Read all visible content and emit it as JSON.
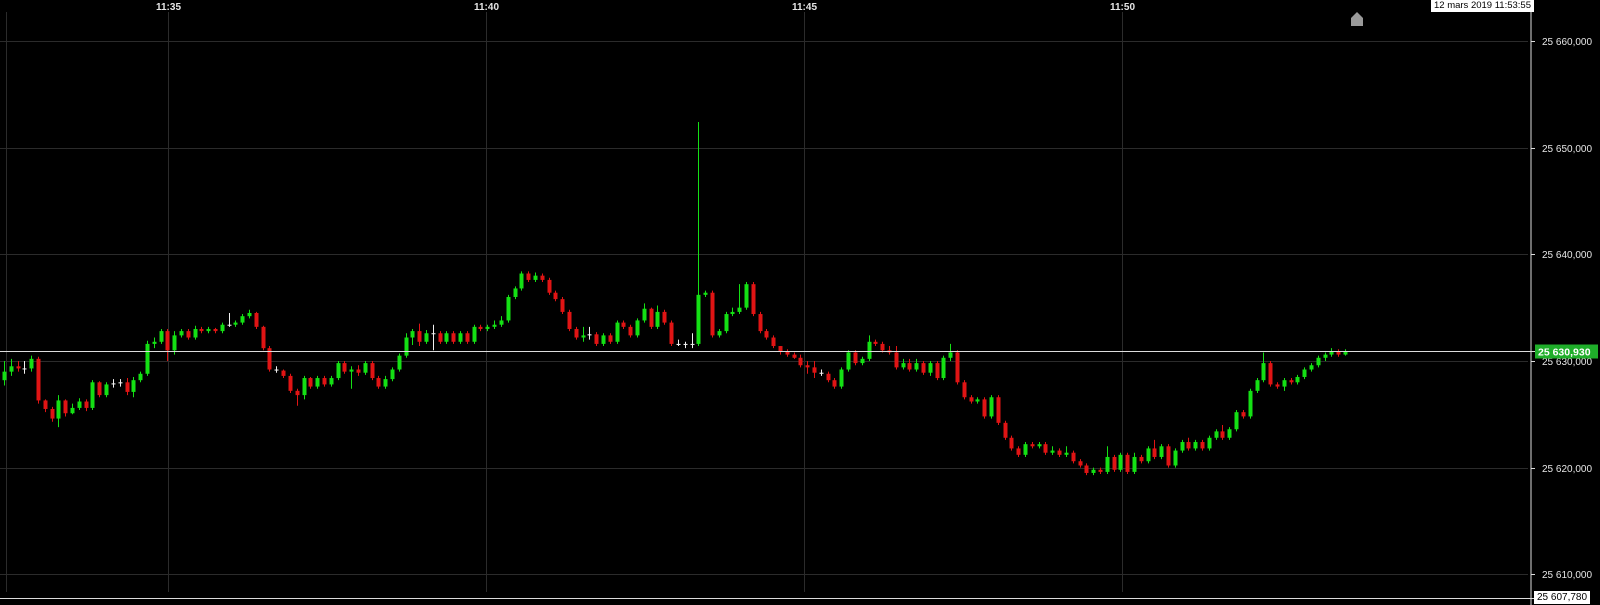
{
  "header": {
    "datetime": "12 mars 2019 11:53:55"
  },
  "colors": {
    "up": "#14e014",
    "down": "#e01414",
    "doji": "#f0f0f0",
    "grid": "#2b2b2b",
    "badge": "#1fae2a",
    "axis_text": "#e6e6e6"
  },
  "icons": {
    "scroll_marker": "home-arrow-icon"
  },
  "chart_data": {
    "type": "candlestick",
    "y_axis": {
      "min": 25607.78,
      "max": 25662,
      "ticks": [
        25610,
        25620,
        25630,
        25640,
        25650,
        25660
      ],
      "tick_labels": [
        "25 610,000",
        "25 620,000",
        "25 630,000",
        "25 640,000",
        "25 650,000",
        "25 660,000"
      ],
      "position": "right"
    },
    "x_axis": {
      "start": "11:32:25",
      "end": "11:53:30",
      "ticks": [
        "11:35",
        "11:40",
        "11:45",
        "11:50"
      ],
      "position": "top"
    },
    "last_price": {
      "value": 25630.93,
      "label": "25 630,930"
    },
    "low_marker": {
      "value": 25607.78,
      "label": "25 607,780"
    },
    "grid": true,
    "candles": [
      [
        25628.2,
        25629.0,
        25630.0,
        25627.7
      ],
      [
        25629.0,
        25629.5,
        25630.2,
        25628.6
      ],
      [
        25629.5,
        25629.3,
        25630.0,
        25629.0
      ],
      [
        25629.3,
        25629.3,
        25630.0,
        25628.8
      ],
      [
        25629.3,
        25630.2,
        25630.5,
        25629.0
      ],
      [
        25630.2,
        25626.3,
        25630.4,
        25626.0
      ],
      [
        25626.3,
        25625.5,
        25626.4,
        25625.2
      ],
      [
        25625.5,
        25624.6,
        25625.7,
        25624.3
      ],
      [
        25624.6,
        25626.3,
        25626.8,
        25623.8
      ],
      [
        25626.3,
        25625.1,
        25626.4,
        25624.8
      ],
      [
        25625.1,
        25625.6,
        25626.0,
        25625.0
      ],
      [
        25625.6,
        25626.2,
        25626.5,
        25625.4
      ],
      [
        25626.2,
        25625.6,
        25626.4,
        25625.3
      ],
      [
        25625.6,
        25628.0,
        25628.2,
        25625.4
      ],
      [
        25628.0,
        25626.8,
        25628.1,
        25626.6
      ],
      [
        25626.8,
        25627.8,
        25628.0,
        25626.6
      ],
      [
        25627.8,
        25627.9,
        25628.3,
        25627.5
      ],
      [
        25627.9,
        25628.0,
        25628.3,
        25627.6
      ],
      [
        25628.0,
        25627.1,
        25628.4,
        25626.8
      ],
      [
        25627.1,
        25628.2,
        25628.5,
        25626.6
      ],
      [
        25628.2,
        25628.8,
        25629.0,
        25628.0
      ],
      [
        25628.8,
        25631.6,
        25631.9,
        25628.6
      ],
      [
        25631.6,
        25631.8,
        25632.2,
        25631.2
      ],
      [
        25631.8,
        25632.8,
        25633.0,
        25631.6
      ],
      [
        25632.8,
        25631.0,
        25633.0,
        25630.0
      ],
      [
        25631.0,
        25632.4,
        25632.8,
        25630.6
      ],
      [
        25632.4,
        25632.8,
        25633.0,
        25632.2
      ],
      [
        25632.8,
        25632.2,
        25633.0,
        25632.0
      ],
      [
        25632.2,
        25633.0,
        25633.3,
        25632.0
      ],
      [
        25633.0,
        25632.8,
        25633.2,
        25632.6
      ],
      [
        25632.8,
        25633.0,
        25633.2,
        25632.6
      ],
      [
        25633.0,
        25632.8,
        25633.1,
        25632.6
      ],
      [
        25632.8,
        25633.4,
        25633.6,
        25632.6
      ],
      [
        25633.4,
        25633.4,
        25634.5,
        25633.2
      ],
      [
        25633.4,
        25633.6,
        25633.8,
        25633.2
      ],
      [
        25633.6,
        25634.2,
        25634.4,
        25633.4
      ],
      [
        25634.2,
        25634.5,
        25634.8,
        25634.0
      ],
      [
        25634.5,
        25633.2,
        25634.6,
        25633.0
      ],
      [
        25633.2,
        25631.2,
        25633.3,
        25631.0
      ],
      [
        25631.2,
        25629.2,
        25631.4,
        25629.0
      ],
      [
        25629.2,
        25629.1,
        25629.5,
        25628.9
      ],
      [
        25629.1,
        25628.6,
        25629.2,
        25628.4
      ],
      [
        25628.6,
        25627.2,
        25628.8,
        25627.0
      ],
      [
        25627.2,
        25626.8,
        25627.4,
        25625.8
      ],
      [
        25626.8,
        25628.4,
        25628.6,
        25626.4
      ],
      [
        25628.4,
        25627.6,
        25628.5,
        25627.4
      ],
      [
        25627.6,
        25628.4,
        25628.6,
        25627.4
      ],
      [
        25628.4,
        25627.8,
        25628.6,
        25627.6
      ],
      [
        25627.8,
        25628.4,
        25628.6,
        25627.6
      ],
      [
        25628.4,
        25629.8,
        25630.0,
        25628.2
      ],
      [
        25629.8,
        25629.0,
        25630.0,
        25628.8
      ],
      [
        25629.0,
        25629.2,
        25629.5,
        25627.4
      ],
      [
        25629.2,
        25628.9,
        25629.6,
        25628.6
      ],
      [
        25628.9,
        25629.8,
        25630.0,
        25628.7
      ],
      [
        25629.8,
        25628.4,
        25630.0,
        25628.2
      ],
      [
        25628.4,
        25627.6,
        25628.6,
        25627.4
      ],
      [
        25627.6,
        25628.3,
        25628.6,
        25627.4
      ],
      [
        25628.3,
        25629.2,
        25629.4,
        25628.1
      ],
      [
        25629.2,
        25630.5,
        25630.7,
        25629.0
      ],
      [
        25630.5,
        25632.2,
        25632.6,
        25630.3
      ],
      [
        25632.2,
        25632.8,
        25633.0,
        25631.5
      ],
      [
        25632.8,
        25631.8,
        25633.5,
        25631.4
      ],
      [
        25631.8,
        25632.6,
        25632.9,
        25631.6
      ],
      [
        25632.6,
        25632.6,
        25633.4,
        25631.0
      ],
      [
        25632.6,
        25631.8,
        25632.8,
        25631.6
      ],
      [
        25631.8,
        25632.6,
        25632.8,
        25631.6
      ],
      [
        25632.6,
        25631.8,
        25632.8,
        25631.6
      ],
      [
        25631.8,
        25632.6,
        25632.8,
        25631.6
      ],
      [
        25632.6,
        25631.8,
        25632.8,
        25631.6
      ],
      [
        25631.8,
        25633.2,
        25633.4,
        25631.6
      ],
      [
        25633.2,
        25633.0,
        25633.4,
        25632.8
      ],
      [
        25633.0,
        25633.2,
        25633.4,
        25632.8
      ],
      [
        25633.2,
        25633.4,
        25633.8,
        25633.0
      ],
      [
        25633.4,
        25633.8,
        25634.2,
        25633.2
      ],
      [
        25633.8,
        25636.0,
        25636.2,
        25633.6
      ],
      [
        25636.0,
        25636.8,
        25637.0,
        25635.8
      ],
      [
        25636.8,
        25638.2,
        25638.4,
        25636.6
      ],
      [
        25638.2,
        25637.6,
        25638.4,
        25637.4
      ],
      [
        25637.6,
        25638.0,
        25638.3,
        25637.4
      ],
      [
        25638.0,
        25637.6,
        25638.2,
        25637.4
      ],
      [
        25637.6,
        25636.4,
        25637.8,
        25636.2
      ],
      [
        25636.4,
        25635.8,
        25636.6,
        25635.6
      ],
      [
        25635.8,
        25634.6,
        25636.0,
        25634.4
      ],
      [
        25634.6,
        25633.0,
        25634.8,
        25632.8
      ],
      [
        25633.0,
        25632.2,
        25633.2,
        25632.0
      ],
      [
        25632.2,
        25632.4,
        25633.2,
        25631.8
      ],
      [
        25632.4,
        25632.5,
        25633.2,
        25632.0
      ],
      [
        25632.5,
        25631.6,
        25632.7,
        25631.4
      ],
      [
        25631.6,
        25632.4,
        25632.6,
        25631.4
      ],
      [
        25632.4,
        25631.8,
        25632.6,
        25631.6
      ],
      [
        25631.8,
        25633.6,
        25633.8,
        25631.6
      ],
      [
        25633.6,
        25633.2,
        25633.8,
        25633.0
      ],
      [
        25633.2,
        25632.4,
        25633.4,
        25632.2
      ],
      [
        25632.4,
        25633.8,
        25634.0,
        25632.2
      ],
      [
        25633.8,
        25634.9,
        25635.4,
        25633.6
      ],
      [
        25634.9,
        25633.2,
        25635.0,
        25633.0
      ],
      [
        25633.2,
        25634.6,
        25635.2,
        25633.0
      ],
      [
        25634.6,
        25633.6,
        25634.8,
        25633.4
      ],
      [
        25633.6,
        25631.6,
        25633.8,
        25631.4
      ],
      [
        25631.6,
        25631.5,
        25632.0,
        25631.4
      ],
      [
        25631.5,
        25631.6,
        25631.8,
        25631.2
      ],
      [
        25631.6,
        25631.6,
        25632.6,
        25631.2
      ],
      [
        25631.6,
        25636.2,
        25652.4,
        25631.4
      ],
      [
        25636.2,
        25636.4,
        25636.6,
        25636.0
      ],
      [
        25636.4,
        25632.4,
        25636.6,
        25632.2
      ],
      [
        25632.4,
        25632.8,
        25633.0,
        25632.2
      ],
      [
        25632.8,
        25634.4,
        25634.6,
        25632.6
      ],
      [
        25634.4,
        25634.6,
        25635.0,
        25634.2
      ],
      [
        25634.6,
        25635.0,
        25637.2,
        25634.4
      ],
      [
        25635.0,
        25637.2,
        25637.4,
        25634.8
      ],
      [
        25637.2,
        25634.4,
        25637.4,
        25634.2
      ],
      [
        25634.4,
        25632.8,
        25634.6,
        25632.6
      ],
      [
        25632.8,
        25632.2,
        25633.0,
        25632.0
      ],
      [
        25632.2,
        25631.4,
        25632.4,
        25631.2
      ],
      [
        25631.4,
        25630.9,
        25631.4,
        25630.6
      ],
      [
        25630.9,
        25630.6,
        25631.1,
        25630.4
      ],
      [
        25630.6,
        25630.3,
        25630.8,
        25630.2
      ],
      [
        25630.3,
        25629.6,
        25630.6,
        25629.4
      ],
      [
        25629.6,
        25629.4,
        25630.0,
        25628.8
      ],
      [
        25629.4,
        25628.9,
        25630.0,
        25628.4
      ],
      [
        25628.9,
        25628.8,
        25629.2,
        25628.6
      ],
      [
        25628.8,
        25628.2,
        25629.0,
        25628.0
      ],
      [
        25628.2,
        25627.6,
        25628.4,
        25627.4
      ],
      [
        25627.6,
        25629.2,
        25629.4,
        25627.4
      ],
      [
        25629.2,
        25630.8,
        25631.0,
        25629.0
      ],
      [
        25630.8,
        25629.8,
        25631.0,
        25629.6
      ],
      [
        25629.8,
        25630.2,
        25630.4,
        25629.6
      ],
      [
        25630.2,
        25631.8,
        25632.4,
        25630.0
      ],
      [
        25631.8,
        25631.6,
        25632.0,
        25631.4
      ],
      [
        25631.6,
        25631.0,
        25631.8,
        25630.8
      ],
      [
        25631.0,
        25630.8,
        25631.4,
        25630.6
      ],
      [
        25630.8,
        25629.4,
        25631.4,
        25629.2
      ],
      [
        25629.4,
        25629.8,
        25630.2,
        25629.2
      ],
      [
        25629.8,
        25629.2,
        25630.2,
        25629.0
      ],
      [
        25629.2,
        25629.8,
        25630.2,
        25629.0
      ],
      [
        25629.8,
        25628.9,
        25630.0,
        25628.7
      ],
      [
        25628.9,
        25629.8,
        25630.0,
        25628.6
      ],
      [
        25629.8,
        25628.4,
        25630.0,
        25628.2
      ],
      [
        25628.4,
        25630.3,
        25630.5,
        25628.2
      ],
      [
        25630.3,
        25630.8,
        25631.6,
        25630.0
      ],
      [
        25630.8,
        25628.0,
        25631.0,
        25627.8
      ],
      [
        25628.0,
        25626.6,
        25628.2,
        25626.4
      ],
      [
        25626.6,
        25626.2,
        25626.8,
        25626.0
      ],
      [
        25626.2,
        25626.4,
        25626.6,
        25626.0
      ],
      [
        25626.4,
        25624.8,
        25626.6,
        25624.6
      ],
      [
        25624.8,
        25626.6,
        25626.8,
        25624.6
      ],
      [
        25626.6,
        25624.2,
        25626.8,
        25624.0
      ],
      [
        25624.2,
        25622.8,
        25624.4,
        25622.6
      ],
      [
        25622.8,
        25621.8,
        25623.0,
        25621.6
      ],
      [
        25621.8,
        25621.2,
        25622.0,
        25621.0
      ],
      [
        25621.2,
        25622.2,
        25622.4,
        25621.0
      ],
      [
        25622.2,
        25622.0,
        25622.4,
        25621.8
      ],
      [
        25622.0,
        25622.2,
        25622.4,
        25621.8
      ],
      [
        25622.2,
        25621.4,
        25622.4,
        25621.2
      ],
      [
        25621.4,
        25621.6,
        25622.0,
        25621.2
      ],
      [
        25621.6,
        25621.2,
        25621.8,
        25621.0
      ],
      [
        25621.2,
        25621.4,
        25622.0,
        25621.0
      ],
      [
        25621.4,
        25620.6,
        25621.6,
        25620.4
      ],
      [
        25620.6,
        25620.2,
        25620.8,
        25620.0
      ],
      [
        25620.2,
        25619.5,
        25620.4,
        25619.3
      ],
      [
        25619.5,
        25619.8,
        25620.0,
        25619.3
      ],
      [
        25619.8,
        25619.6,
        25620.0,
        25619.4
      ],
      [
        25619.6,
        25621.0,
        25622.0,
        25619.4
      ],
      [
        25621.0,
        25619.8,
        25621.2,
        25619.6
      ],
      [
        25619.8,
        25621.2,
        25621.4,
        25619.6
      ],
      [
        25621.2,
        25619.6,
        25621.4,
        25619.4
      ],
      [
        25619.6,
        25621.0,
        25621.4,
        25619.4
      ],
      [
        25621.0,
        25620.6,
        25621.2,
        25620.4
      ],
      [
        25620.6,
        25621.8,
        25622.0,
        25620.4
      ],
      [
        25621.8,
        25621.0,
        25622.6,
        25620.8
      ],
      [
        25621.0,
        25622.0,
        25622.2,
        25620.8
      ],
      [
        25622.0,
        25620.2,
        25622.2,
        25620.0
      ],
      [
        25620.2,
        25621.6,
        25621.8,
        25620.0
      ],
      [
        25621.6,
        25622.4,
        25622.6,
        25621.4
      ],
      [
        25622.4,
        25621.8,
        25622.8,
        25621.6
      ],
      [
        25621.8,
        25622.4,
        25622.6,
        25621.6
      ],
      [
        25622.4,
        25621.8,
        25622.6,
        25621.6
      ],
      [
        25621.8,
        25622.8,
        25623.0,
        25621.6
      ],
      [
        25622.8,
        25623.4,
        25623.6,
        25622.6
      ],
      [
        25623.4,
        25622.8,
        25624.0,
        25622.6
      ],
      [
        25622.8,
        25623.6,
        25623.8,
        25622.6
      ],
      [
        25623.6,
        25625.2,
        25625.4,
        25623.4
      ],
      [
        25625.2,
        25624.8,
        25625.4,
        25624.6
      ],
      [
        25624.8,
        25627.2,
        25627.4,
        25624.6
      ],
      [
        25627.2,
        25628.2,
        25628.4,
        25627.0
      ],
      [
        25628.2,
        25629.8,
        25630.8,
        25628.0
      ],
      [
        25629.8,
        25627.8,
        25630.0,
        25627.6
      ],
      [
        25627.8,
        25627.6,
        25628.0,
        25627.4
      ],
      [
        25627.6,
        25628.2,
        25628.4,
        25627.2
      ],
      [
        25628.2,
        25628.0,
        25628.4,
        25627.8
      ],
      [
        25628.0,
        25628.5,
        25628.7,
        25627.8
      ],
      [
        25628.5,
        25629.2,
        25629.4,
        25628.3
      ],
      [
        25629.2,
        25629.6,
        25629.8,
        25629.0
      ],
      [
        25629.6,
        25630.3,
        25630.5,
        25629.4
      ],
      [
        25630.3,
        25630.6,
        25630.8,
        25630.0
      ],
      [
        25630.6,
        25630.9,
        25631.2,
        25630.4
      ],
      [
        25630.9,
        25630.6,
        25631.1,
        25630.4
      ],
      [
        25630.6,
        25630.93,
        25631.1,
        25630.5
      ]
    ]
  }
}
